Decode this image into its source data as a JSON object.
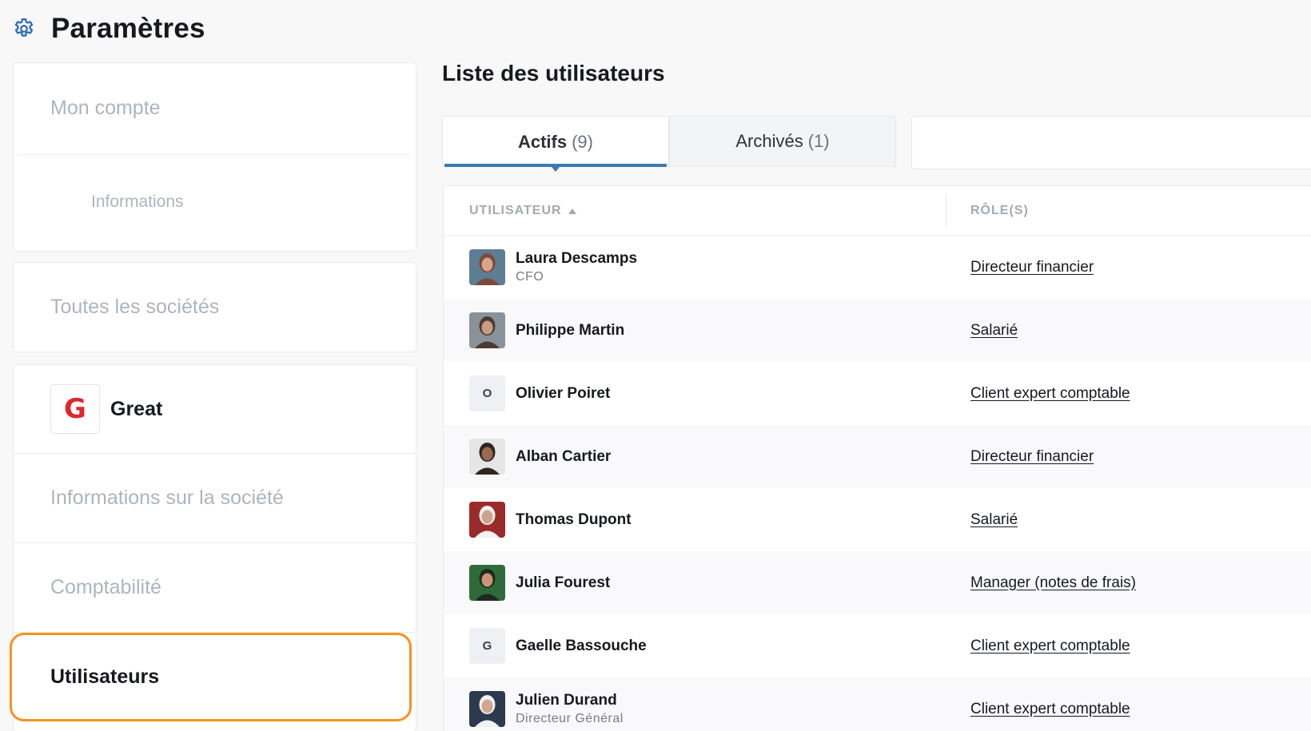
{
  "header": {
    "title": "Paramètres",
    "icon": "gear-icon"
  },
  "sidebar": {
    "account": {
      "title": "Mon compte",
      "sub_item": "Informations"
    },
    "all_companies": "Toutes les sociétés",
    "company": {
      "logo_letter": "G",
      "name": "Great",
      "items": [
        "Informations sur la société",
        "Comptabilité"
      ],
      "active_item": "Utilisateurs"
    }
  },
  "main": {
    "title": "Liste des utilisateurs",
    "tabs": [
      {
        "label": "Actifs",
        "count": "(9)",
        "active": true
      },
      {
        "label": "Archivés",
        "count": "(1)",
        "active": false
      }
    ],
    "table": {
      "columns": [
        "UTILISATEUR",
        "RÔLE(S)"
      ],
      "rows": [
        {
          "name": "Laura Descamps",
          "subtitle": "CFO",
          "role": "Directeur financier",
          "avatar": "photo"
        },
        {
          "name": "Philippe Martin",
          "subtitle": "",
          "role": "Salarié",
          "avatar": "photo"
        },
        {
          "name": "Olivier Poiret",
          "subtitle": "",
          "role": "Client expert comptable",
          "avatar": "O"
        },
        {
          "name": "Alban Cartier",
          "subtitle": "",
          "role": "Directeur financier",
          "avatar": "photo"
        },
        {
          "name": "Thomas Dupont",
          "subtitle": "",
          "role": "Salarié",
          "avatar": "photo"
        },
        {
          "name": "Julia Fourest",
          "subtitle": "",
          "role": "Manager (notes de frais)",
          "avatar": "photo"
        },
        {
          "name": "Gaelle Bassouche",
          "subtitle": "",
          "role": "Client expert comptable",
          "avatar": "G"
        },
        {
          "name": "Julien Durand",
          "subtitle": "Directeur Général",
          "role": "Client expert comptable",
          "avatar": "photo"
        }
      ]
    }
  },
  "colors": {
    "accent": "#3a7bb0",
    "highlight": "#f7931e",
    "brand_red": "#e0262b"
  }
}
